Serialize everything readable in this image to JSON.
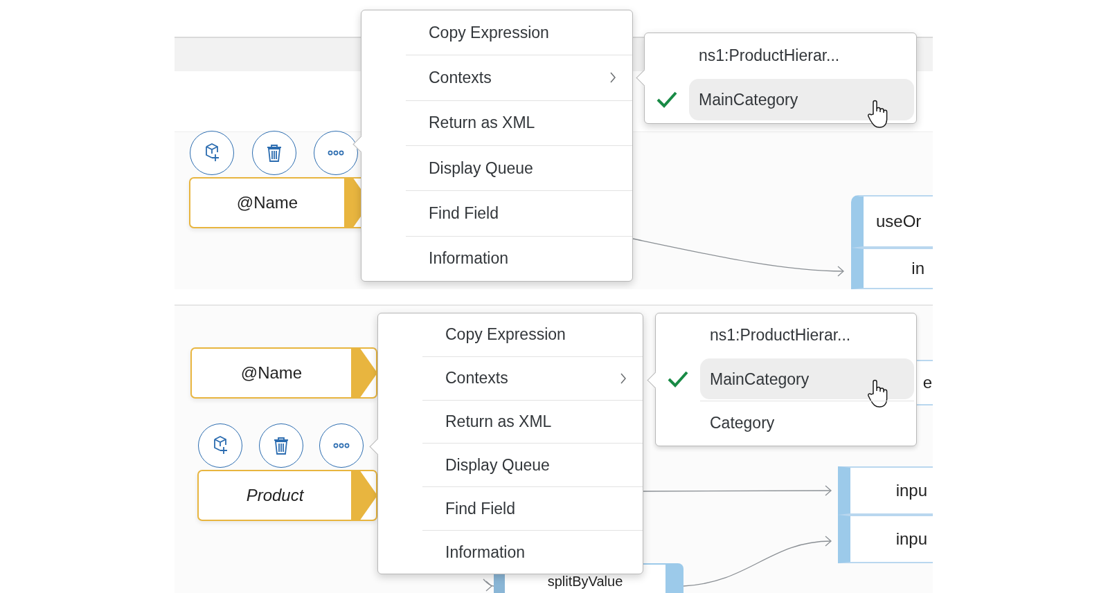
{
  "panels": [
    {
      "source_nodes": [
        {
          "label": "@Name",
          "kind": "attribute"
        }
      ],
      "context_menu": [
        {
          "label": "Copy Expression",
          "submenu": false
        },
        {
          "label": "Contexts",
          "submenu": true
        },
        {
          "label": "Return as XML",
          "submenu": false
        },
        {
          "label": "Display Queue",
          "submenu": false
        },
        {
          "label": "Find Field",
          "submenu": false
        },
        {
          "label": "Information",
          "submenu": false
        }
      ],
      "contexts_submenu": [
        {
          "label": "ns1:ProductHierar...",
          "checked": false,
          "selected": false
        },
        {
          "label": "MainCategory",
          "checked": true,
          "selected": true
        }
      ],
      "target_nodes": [
        {
          "label": "useOr",
          "kind": "header"
        },
        {
          "label": "in",
          "kind": "row"
        }
      ]
    },
    {
      "source_nodes": [
        {
          "label": "@Name",
          "kind": "attribute"
        },
        {
          "label": "Product",
          "kind": "element"
        }
      ],
      "context_menu": [
        {
          "label": "Copy Expression",
          "submenu": false
        },
        {
          "label": "Contexts",
          "submenu": true
        },
        {
          "label": "Return as XML",
          "submenu": false
        },
        {
          "label": "Display Queue",
          "submenu": false
        },
        {
          "label": "Find Field",
          "submenu": false
        },
        {
          "label": "Information",
          "submenu": false
        }
      ],
      "contexts_submenu": [
        {
          "label": "ns1:ProductHierar...",
          "checked": false,
          "selected": false
        },
        {
          "label": "MainCategory",
          "checked": true,
          "selected": true
        },
        {
          "label": "Category",
          "checked": false,
          "selected": false
        }
      ],
      "target_nodes": [
        {
          "label": "e",
          "kind": "row"
        },
        {
          "label": "inpu",
          "kind": "row"
        },
        {
          "label": "inpu",
          "kind": "row"
        },
        {
          "label": "splitByValue",
          "kind": "function"
        }
      ]
    }
  ]
}
